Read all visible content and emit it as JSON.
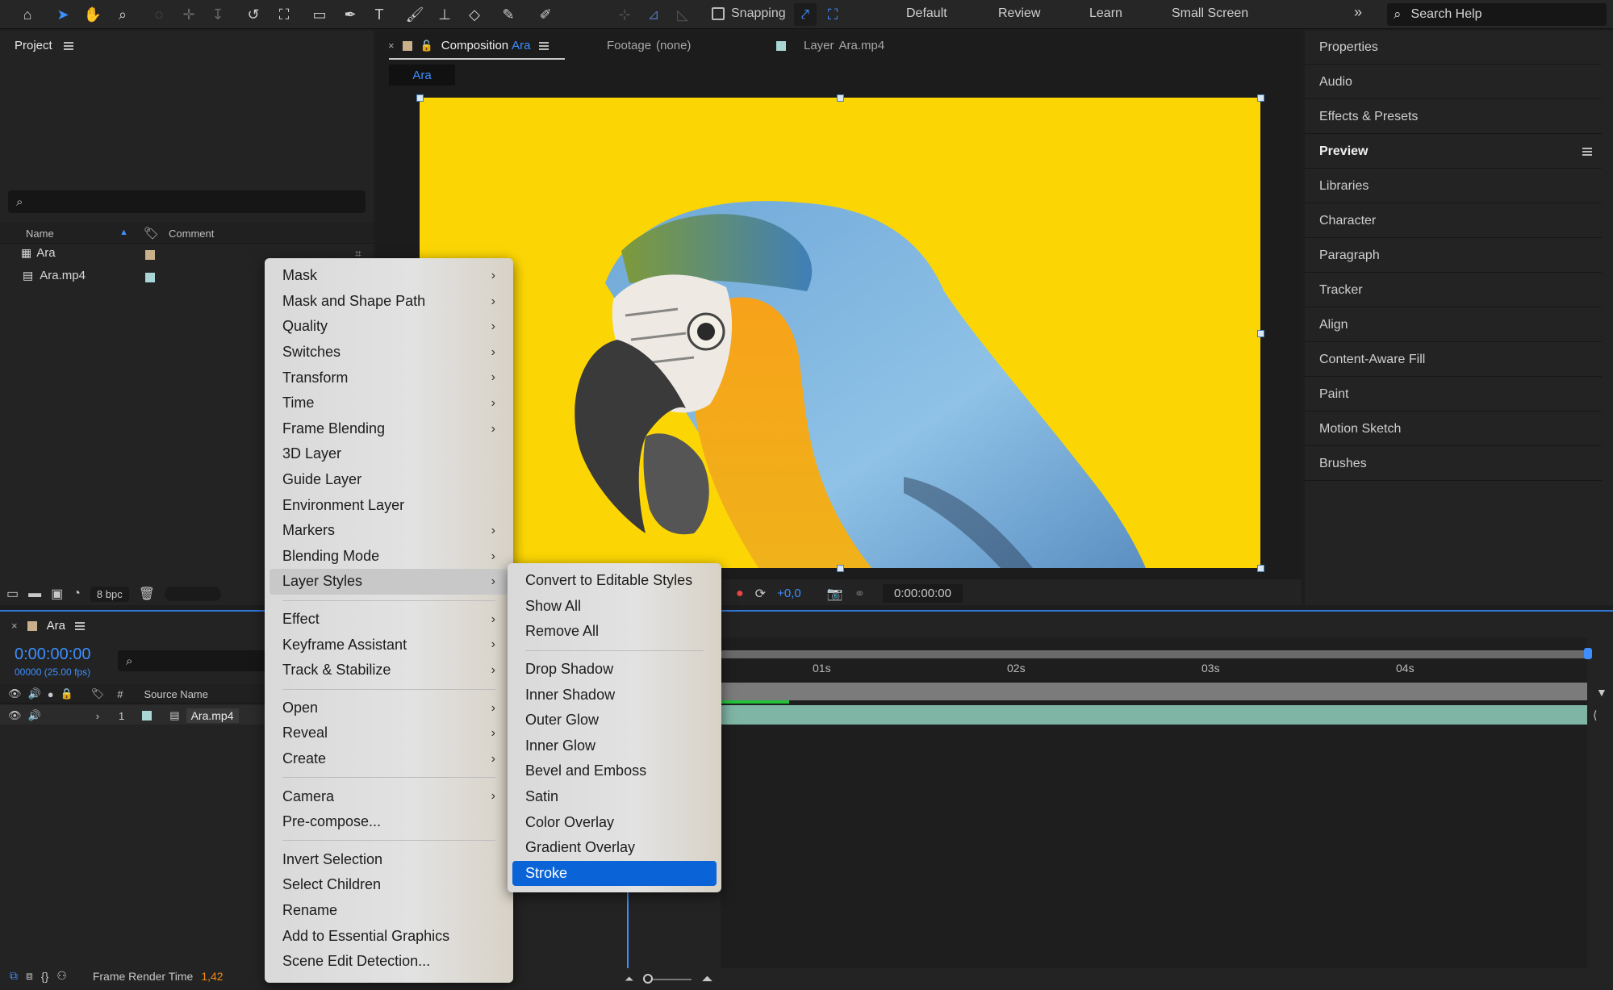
{
  "toolbar": {
    "tools": [
      "home-icon",
      "selection-tool-icon",
      "hand-tool-icon",
      "zoom-tool-icon",
      "orbit-camera-icon",
      "pan-camera-icon",
      "dolly-camera-icon",
      "rotate-tool-icon",
      "pan-behind-icon",
      "rectangle-tool-icon",
      "pen-tool-icon",
      "type-tool-icon",
      "brush-tool-icon",
      "clone-stamp-icon",
      "eraser-icon",
      "roto-brush-icon",
      "puppet-tool-icon"
    ],
    "snapping_label": "Snapping",
    "workspaces": [
      "Default",
      "Review",
      "Learn",
      "Small Screen"
    ],
    "search_placeholder": "Search Help"
  },
  "project": {
    "title": "Project",
    "columns": {
      "name": "Name",
      "comment": "Comment"
    },
    "items": [
      {
        "name": "Ara",
        "type": "composition",
        "label_color": "#c9b08a"
      },
      {
        "name": "Ara.mp4",
        "type": "footage",
        "label_color": "#a9d5d5"
      }
    ],
    "footer_bpc": "8 bpc"
  },
  "viewer": {
    "tabs": [
      {
        "prefix": "Composition",
        "name": "Ara"
      },
      {
        "prefix": "Footage",
        "name": "(none)"
      },
      {
        "prefix": "Layer",
        "name": "Ara.mp4"
      }
    ],
    "sub_tab": "Ara",
    "exposure": "+0,0",
    "timecode": "0:00:00:00",
    "canvas_color": "#fcd604"
  },
  "right_panel": {
    "items": [
      "Properties",
      "Audio",
      "Effects & Presets",
      "Preview",
      "Libraries",
      "Character",
      "Paragraph",
      "Tracker",
      "Align",
      "Content-Aware Fill",
      "Paint",
      "Motion Sketch",
      "Brushes"
    ],
    "bold_item": "Preview"
  },
  "timeline": {
    "comp_name": "Ara",
    "timecode": "0:00:00:00",
    "frames": "00000 (25.00 fps)",
    "columns": {
      "number": "#",
      "source": "Source Name"
    },
    "layer": {
      "number": "1",
      "name": "Ara.mp4"
    },
    "ruler_ticks": [
      "01s",
      "02s",
      "03s",
      "04s"
    ],
    "footer_label": "Frame Render Time",
    "footer_value": "1,42"
  },
  "context_menu": {
    "items": [
      {
        "label": "Mask",
        "submenu": true
      },
      {
        "label": "Mask and Shape Path",
        "submenu": true
      },
      {
        "label": "Quality",
        "submenu": true
      },
      {
        "label": "Switches",
        "submenu": true
      },
      {
        "label": "Transform",
        "submenu": true
      },
      {
        "label": "Time",
        "submenu": true
      },
      {
        "label": "Frame Blending",
        "submenu": true
      },
      {
        "label": "3D Layer",
        "submenu": false
      },
      {
        "label": "Guide Layer",
        "submenu": false
      },
      {
        "label": "Environment Layer",
        "submenu": false
      },
      {
        "label": "Markers",
        "submenu": true
      },
      {
        "label": "Blending Mode",
        "submenu": true
      },
      {
        "label": "Layer Styles",
        "submenu": true,
        "highlighted": true
      },
      {
        "separator": true
      },
      {
        "label": "Effect",
        "submenu": true
      },
      {
        "label": "Keyframe Assistant",
        "submenu": true
      },
      {
        "label": "Track & Stabilize",
        "submenu": true
      },
      {
        "separator": true
      },
      {
        "label": "Open",
        "submenu": true
      },
      {
        "label": "Reveal",
        "submenu": true
      },
      {
        "label": "Create",
        "submenu": true
      },
      {
        "separator": true
      },
      {
        "label": "Camera",
        "submenu": true
      },
      {
        "label": "Pre-compose...",
        "submenu": false
      },
      {
        "separator": true
      },
      {
        "label": "Invert Selection",
        "submenu": false
      },
      {
        "label": "Select Children",
        "submenu": false
      },
      {
        "label": "Rename",
        "submenu": false
      },
      {
        "label": "Add to Essential Graphics",
        "submenu": false
      },
      {
        "label": "Scene Edit Detection...",
        "submenu": false
      }
    ]
  },
  "layer_styles_menu": {
    "items": [
      {
        "label": "Convert to Editable Styles"
      },
      {
        "label": "Show All"
      },
      {
        "label": "Remove All"
      },
      {
        "separator": true
      },
      {
        "label": "Drop Shadow"
      },
      {
        "label": "Inner Shadow"
      },
      {
        "label": "Outer Glow"
      },
      {
        "label": "Inner Glow"
      },
      {
        "label": "Bevel and Emboss"
      },
      {
        "label": "Satin"
      },
      {
        "label": "Color Overlay"
      },
      {
        "label": "Gradient Overlay"
      },
      {
        "label": "Stroke",
        "selected": true
      }
    ]
  }
}
